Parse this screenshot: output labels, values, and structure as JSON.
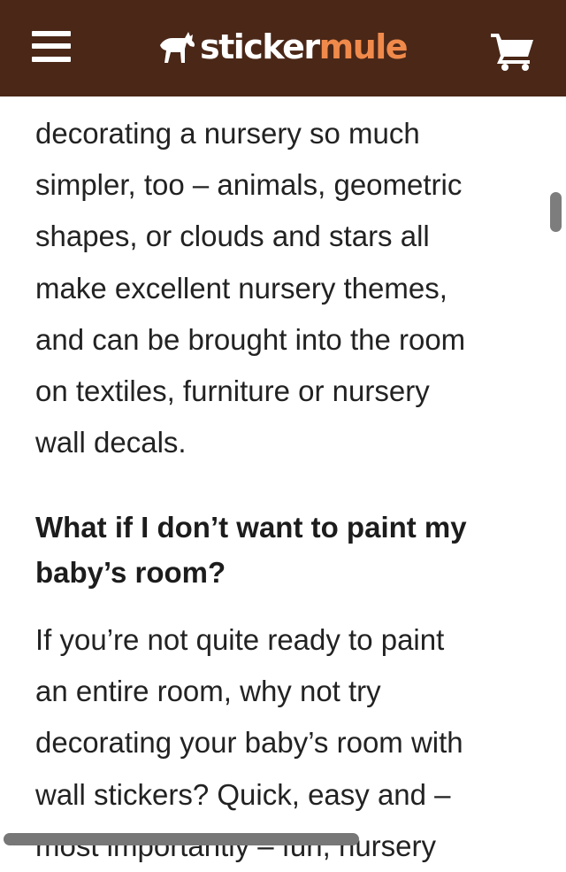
{
  "header": {
    "brand_primary": "sticker",
    "brand_secondary": "mule",
    "background_color": "#4a2717",
    "brand_accent_color": "#f08a4b",
    "icons": [
      "menu-icon",
      "mule-logo-icon",
      "cart-icon"
    ]
  },
  "article": {
    "paragraph_1": "decorating a nursery so much\nsimpler, too – animals, geometric\nshapes, or clouds and stars all\nmake excellent nursery themes,\nand can be brought into the room\non textiles, furniture or nursery\nwall decals.",
    "heading_1": "What if I don’t want to paint my\nbaby’s room?",
    "paragraph_2": "If you’re not quite ready to paint\nan entire room, why not try\ndecorating your baby’s room with\nwall stickers? Quick, easy and –\nmost importantly – fun, nursery"
  }
}
